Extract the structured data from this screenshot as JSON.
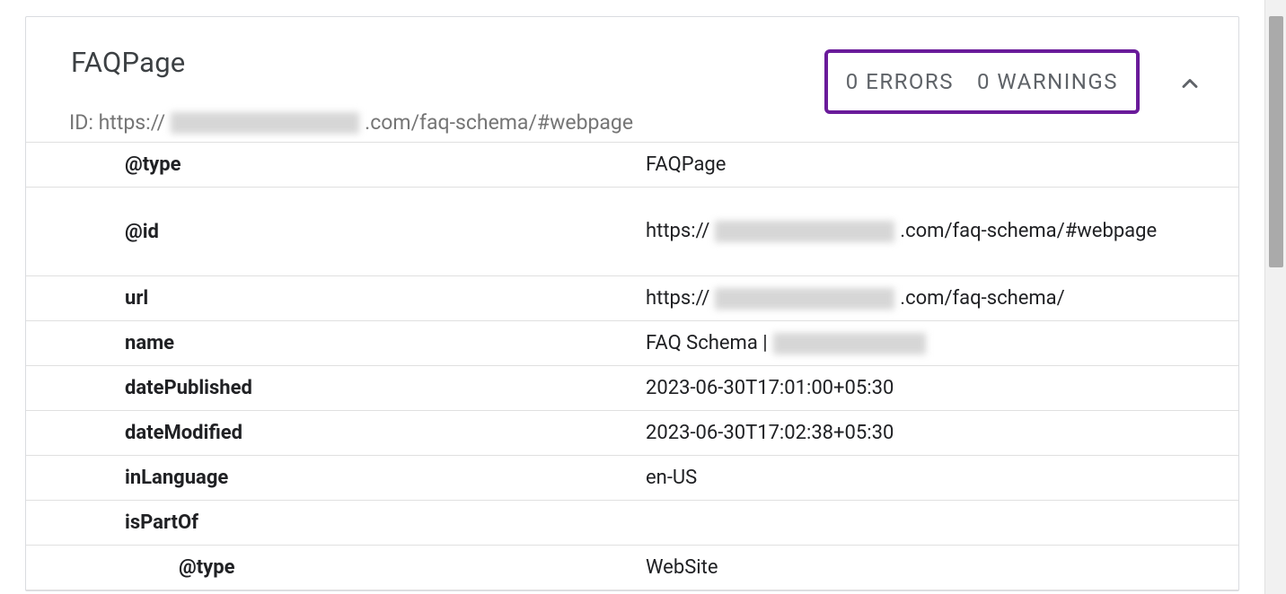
{
  "header": {
    "title": "FAQPage",
    "id_prefix": "ID: https://",
    "id_suffix": ".com/faq-schema/#webpage",
    "errors_label": "0 ERRORS",
    "warnings_label": "0 WARNINGS"
  },
  "rows": {
    "type_key": "@type",
    "type_val": "FAQPage",
    "id_key": "@id",
    "id_val_prefix": "https://",
    "id_val_suffix": ".com/faq-schema/#webpage",
    "url_key": "url",
    "url_val_prefix": "https://",
    "url_val_suffix": ".com/faq-schema/",
    "name_key": "name",
    "name_val_prefix": "FAQ Schema | ",
    "datePublished_key": "datePublished",
    "datePublished_val": "2023-06-30T17:01:00+05:30",
    "dateModified_key": "dateModified",
    "dateModified_val": "2023-06-30T17:02:38+05:30",
    "inLanguage_key": "inLanguage",
    "inLanguage_val": "en-US",
    "isPartOf_key": "isPartOf",
    "nested_type_key": "@type",
    "nested_type_val": "WebSite"
  }
}
